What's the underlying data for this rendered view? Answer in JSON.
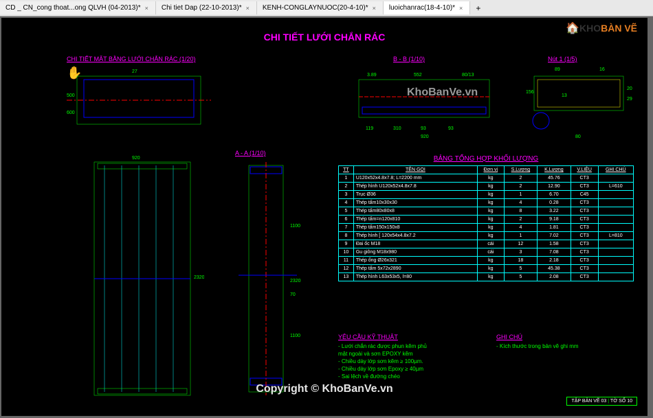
{
  "tabs": {
    "items": [
      {
        "label": "CD _ CN_cong thoat...ong QLVH (04-2013)*"
      },
      {
        "label": "Chi tiet Dap (22-10-2013)*"
      },
      {
        "label": "KENH-CONGLAYNUOC(20-4-10)*"
      },
      {
        "label": "luoichanrac(18-4-10)*",
        "active": true
      }
    ]
  },
  "watermark": {
    "logo_k": "KHO",
    "logo_b": "BÀN VẼ",
    "center": "KhoBanVe.vn",
    "copyright": "Copyright © KhoBanVe.vn"
  },
  "drawing": {
    "main_title": "CHI TIẾT LƯỚI CHẮN RÁC",
    "section_mb": "CHI TIẾT MẶT BẰNG LƯỚI CHẮN RÁC (1/20)",
    "section_aa": "A - A (1/10)",
    "section_bb": "B - B (1/10)",
    "section_nut": "Nút 1 (1/5)",
    "dims": {
      "d27": "27",
      "d500": "500",
      "d600": "600",
      "d920": "920",
      "d389": "3.89",
      "d552": "552",
      "d8013": "80/13",
      "d119": "119",
      "d310": "310",
      "d93": "93",
      "d2320": "2320",
      "d1100": "1100",
      "d70": "70",
      "d80": "80",
      "d89": "89",
      "d16": "16",
      "d156": "156",
      "d13": "13",
      "d20": "20",
      "d29": "29"
    }
  },
  "table": {
    "title": "BẢNG TỔNG HỢP KHỐI LƯỢNG",
    "headers": [
      "TT",
      "TÊN GỌI",
      "Đơn vị",
      "S.Lượng",
      "K.Lượng",
      "V.LIỆU",
      "GHI CHÚ"
    ],
    "rows": [
      [
        "1",
        "U120x52x4.8x7.8; L=2200 mm",
        "kg",
        "2",
        "45.76",
        "CT3",
        ""
      ],
      [
        "2",
        "Thép hình U120x52x4.8x7.8",
        "kg",
        "2",
        "12.90",
        "CT3",
        "L=610"
      ],
      [
        "3",
        "Trục Ø36",
        "kg",
        "1",
        "6.70",
        "C45",
        ""
      ],
      [
        "4",
        "Thép tấm10x30x30",
        "kg",
        "4",
        "0.28",
        "CT3",
        ""
      ],
      [
        "5",
        "Thép tấm80x80x8",
        "kg",
        "8",
        "3.22",
        "CT3",
        ""
      ],
      [
        "6",
        "Thép tấm=n120x810",
        "kg",
        "2",
        "9.18",
        "CT3",
        ""
      ],
      [
        "7",
        "Thép tấm150x150x8",
        "kg",
        "4",
        "1.81",
        "CT3",
        ""
      ],
      [
        "8",
        "Thép hình [ 120x54x4.8x7.2",
        "kg",
        "1",
        "7.02",
        "CT3",
        "L=810"
      ],
      [
        "9",
        "Đai ốc M18",
        "cái",
        "12",
        "1.58",
        "CT3",
        ""
      ],
      [
        "10",
        "Gu giông M18x980",
        "cái",
        "3",
        "7.08",
        "CT3",
        ""
      ],
      [
        "11",
        "Thép ống Ø26x321",
        "kg",
        "18",
        "2.18",
        "CT3",
        ""
      ],
      [
        "12",
        "Thép tấm 5x72x2890",
        "kg",
        "5",
        "45.38",
        "CT3",
        ""
      ],
      [
        "13",
        "Thép hình L63x53x5, l=80",
        "kg",
        "5",
        "2.08",
        "CT3",
        ""
      ]
    ]
  },
  "notes": {
    "title": "YÊU CẦU KỸ THUẬT",
    "lines": [
      "- Lưới chắn rác được phun kẽm phủ",
      "  mặt ngoài và sơn EPOXY kẽm",
      "- Chiều dày lớp sơn kẽm ≥ 100µm.",
      "- Chiều dày lớp sơn Epoxy ≥ 40µm",
      "- Sai lệch về đường chéo"
    ],
    "ghichu_title": "GHI CHÚ",
    "ghichu_line": "- Kích thước trong bản vẽ ghi mm"
  },
  "sheet": {
    "label1": "TẬP BẢN VẼ 03",
    "label2": "TỜ SỐ 10"
  }
}
